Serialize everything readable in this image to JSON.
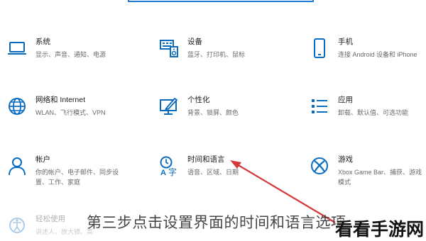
{
  "tiles": {
    "system": {
      "title": "系统",
      "desc": "显示、声音、通知、电源"
    },
    "devices": {
      "title": "设备",
      "desc": "蓝牙、打印机、鼠标"
    },
    "phone": {
      "title": "手机",
      "desc": "连接 Android 设备和 iPhone"
    },
    "network": {
      "title": "网络和 Internet",
      "desc": "WLAN、飞行模式、VPN"
    },
    "personalization": {
      "title": "个性化",
      "desc": "背景、锁屏、颜色"
    },
    "apps": {
      "title": "应用",
      "desc": "卸载、默认值、可选功能"
    },
    "accounts": {
      "title": "帐户",
      "desc_line1": "你的帐户、电子邮件、同步设",
      "desc_line2": "置、工作、家庭"
    },
    "time_language": {
      "title": "时间和语言",
      "desc": "语音、区域、日期"
    },
    "gaming": {
      "title": "游戏",
      "desc_line1": "Xbox Game Bar、捕获、游戏",
      "desc_line2": "模式"
    },
    "ease_of_access": {
      "title": "轻松使用",
      "desc": "讲述人、放大镜、高"
    }
  },
  "caption": "第三步点击设置界面的时间和语言选项",
  "watermark": "看看手游网",
  "colors": {
    "accent": "#0b6cbf",
    "arrow": "#d43a3a"
  },
  "icons": [
    "laptop-icon",
    "keyboard-speaker-icon",
    "phone-icon",
    "globe-icon",
    "paint-monitor-icon",
    "apps-list-icon",
    "person-icon",
    "time-language-icon",
    "xbox-icon",
    "ease-of-access-icon"
  ]
}
